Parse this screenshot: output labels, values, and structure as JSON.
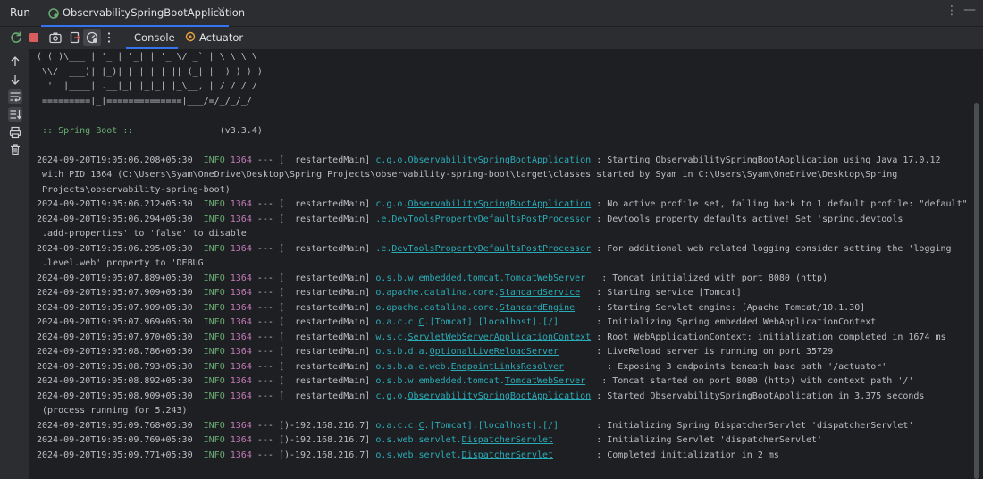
{
  "window": {
    "run_label": "Run",
    "tab_label": "ObservabilitySpringBootApplication",
    "close_glyph": "×",
    "more_glyph": "⋮",
    "minimize_glyph": "—"
  },
  "toolbar": {
    "tabs": [
      {
        "label": "Console",
        "active": true
      },
      {
        "label": "Actuator",
        "active": false
      }
    ],
    "icons": [
      "rerun-icon",
      "stop-icon",
      "camera-icon",
      "exit-icon",
      "settings-gauge-icon",
      "more-icon"
    ]
  },
  "gutter": {
    "icons": [
      "scroll-up-icon",
      "scroll-down-icon",
      "soft-wrap-icon",
      "scroll-to-end-icon",
      "print-icon",
      "trash-icon"
    ]
  },
  "console": {
    "banner": [
      "( ( )\\___ | '_ | '_| | '_ \\/ _` | \\ \\ \\ \\",
      " \\\\/  ___)| |_)| | | | | || (_| |  ) ) ) )",
      "  '  |____| .__|_| |_|_| |_\\__, | / / / /",
      " =========|_|==============|___/=/_/_/_/"
    ],
    "boot_label": " :: Spring Boot ::",
    "boot_version": "(v3.3.4)",
    "logs": [
      {
        "ts": "2024-09-20T19:05:06.208+05:30",
        "lvl": "INFO",
        "pid": "1364",
        "sep": "--- [  restartedMain]",
        "cls_pre": "c.g.o.",
        "cls_u": "ObservabilitySpringBootApplication",
        "cls_post": "",
        "msg": " : Starting ObservabilitySpringBootApplication using Java 17.0.12",
        "cont": [
          " with PID 1364 (C:\\Users\\Syam\\OneDrive\\Desktop\\Spring Projects\\observability-spring-boot\\target\\classes started by Syam in C:\\Users\\Syam\\OneDrive\\Desktop\\Spring",
          " Projects\\observability-spring-boot)"
        ]
      },
      {
        "ts": "2024-09-20T19:05:06.212+05:30",
        "lvl": "INFO",
        "pid": "1364",
        "sep": "--- [  restartedMain]",
        "cls_pre": "c.g.o.",
        "cls_u": "ObservabilitySpringBootApplication",
        "cls_post": "",
        "msg": " : No active profile set, falling back to 1 default profile: \"default\"",
        "cont": []
      },
      {
        "ts": "2024-09-20T19:05:06.294+05:30",
        "lvl": "INFO",
        "pid": "1364",
        "sep": "--- [  restartedMain]",
        "cls_pre": ".e.",
        "cls_u": "DevToolsPropertyDefaultsPostProcessor",
        "cls_post": "",
        "msg": " : Devtools property defaults active! Set 'spring.devtools",
        "cont": [
          " .add-properties' to 'false' to disable"
        ]
      },
      {
        "ts": "2024-09-20T19:05:06.295+05:30",
        "lvl": "INFO",
        "pid": "1364",
        "sep": "--- [  restartedMain]",
        "cls_pre": ".e.",
        "cls_u": "DevToolsPropertyDefaultsPostProcessor",
        "cls_post": "",
        "msg": " : For additional web related logging consider setting the 'logging",
        "cont": [
          " .level.web' property to 'DEBUG'"
        ]
      },
      {
        "ts": "2024-09-20T19:05:07.889+05:30",
        "lvl": "INFO",
        "pid": "1364",
        "sep": "--- [  restartedMain]",
        "cls_pre": "o.s.b.w.embedded.tomcat.",
        "cls_u": "TomcatWebServer",
        "cls_post": "  ",
        "msg": " : Tomcat initialized with port 8080 (http)",
        "cont": []
      },
      {
        "ts": "2024-09-20T19:05:07.909+05:30",
        "lvl": "INFO",
        "pid": "1364",
        "sep": "--- [  restartedMain]",
        "cls_pre": "o.apache.catalina.core.",
        "cls_u": "StandardService",
        "cls_post": "  ",
        "msg": " : Starting service [Tomcat]",
        "cont": []
      },
      {
        "ts": "2024-09-20T19:05:07.909+05:30",
        "lvl": "INFO",
        "pid": "1364",
        "sep": "--- [  restartedMain]",
        "cls_pre": "o.apache.catalina.core.",
        "cls_u": "StandardEngine",
        "cls_post": "   ",
        "msg": " : Starting Servlet engine: [Apache Tomcat/10.1.30]",
        "cont": []
      },
      {
        "ts": "2024-09-20T19:05:07.969+05:30",
        "lvl": "INFO",
        "pid": "1364",
        "sep": "--- [  restartedMain]",
        "cls_pre": "o.a.c.c.",
        "cls_u": "C",
        "cls_post": ".[Tomcat].[localhost].[/]      ",
        "msg": " : Initializing Spring embedded WebApplicationContext",
        "cont": []
      },
      {
        "ts": "2024-09-20T19:05:07.970+05:30",
        "lvl": "INFO",
        "pid": "1364",
        "sep": "--- [  restartedMain]",
        "cls_pre": "w.s.c.",
        "cls_u": "ServletWebServerApplicationContext",
        "cls_post": "",
        "msg": " : Root WebApplicationContext: initialization completed in 1674 ms",
        "cont": []
      },
      {
        "ts": "2024-09-20T19:05:08.786+05:30",
        "lvl": "INFO",
        "pid": "1364",
        "sep": "--- [  restartedMain]",
        "cls_pre": "o.s.b.d.a.",
        "cls_u": "OptionalLiveReloadServer",
        "cls_post": "      ",
        "msg": " : LiveReload server is running on port 35729",
        "cont": []
      },
      {
        "ts": "2024-09-20T19:05:08.793+05:30",
        "lvl": "INFO",
        "pid": "1364",
        "sep": "--- [  restartedMain]",
        "cls_pre": "o.s.b.a.e.web.",
        "cls_u": "EndpointLinksResolver",
        "cls_post": "       ",
        "msg": " : Exposing 3 endpoints beneath base path '/actuator'",
        "cont": []
      },
      {
        "ts": "2024-09-20T19:05:08.892+05:30",
        "lvl": "INFO",
        "pid": "1364",
        "sep": "--- [  restartedMain]",
        "cls_pre": "o.s.b.w.embedded.tomcat.",
        "cls_u": "TomcatWebServer",
        "cls_post": "  ",
        "msg": " : Tomcat started on port 8080 (http) with context path '/'",
        "cont": []
      },
      {
        "ts": "2024-09-20T19:05:08.909+05:30",
        "lvl": "INFO",
        "pid": "1364",
        "sep": "--- [  restartedMain]",
        "cls_pre": "c.g.o.",
        "cls_u": "ObservabilitySpringBootApplication",
        "cls_post": "",
        "msg": " : Started ObservabilitySpringBootApplication in 3.375 seconds",
        "cont": [
          " (process running for 5.243)"
        ]
      },
      {
        "ts": "2024-09-20T19:05:09.768+05:30",
        "lvl": "INFO",
        "pid": "1364",
        "sep": "--- [)-192.168.216.7]",
        "cls_pre": "o.a.c.c.",
        "cls_u": "C",
        "cls_post": ".[Tomcat].[localhost].[/]      ",
        "msg": " : Initializing Spring DispatcherServlet 'dispatcherServlet'",
        "cont": []
      },
      {
        "ts": "2024-09-20T19:05:09.769+05:30",
        "lvl": "INFO",
        "pid": "1364",
        "sep": "--- [)-192.168.216.7]",
        "cls_pre": "o.s.web.servlet.",
        "cls_u": "DispatcherServlet",
        "cls_post": "       ",
        "msg": " : Initializing Servlet 'dispatcherServlet'",
        "cont": []
      },
      {
        "ts": "2024-09-20T19:05:09.771+05:30",
        "lvl": "INFO",
        "pid": "1364",
        "sep": "--- [)-192.168.216.7]",
        "cls_pre": "o.s.web.servlet.",
        "cls_u": "DispatcherServlet",
        "cls_post": "       ",
        "msg": " : Completed initialization in 2 ms",
        "cont": []
      }
    ]
  },
  "colors": {
    "background": "#1e1f22",
    "panel": "#2b2d30",
    "accent": "#3574f0",
    "info_green": "#6aab73",
    "pid_purple": "#c77dbb",
    "class_teal": "#2aacb8",
    "text": "#bcbec4"
  }
}
